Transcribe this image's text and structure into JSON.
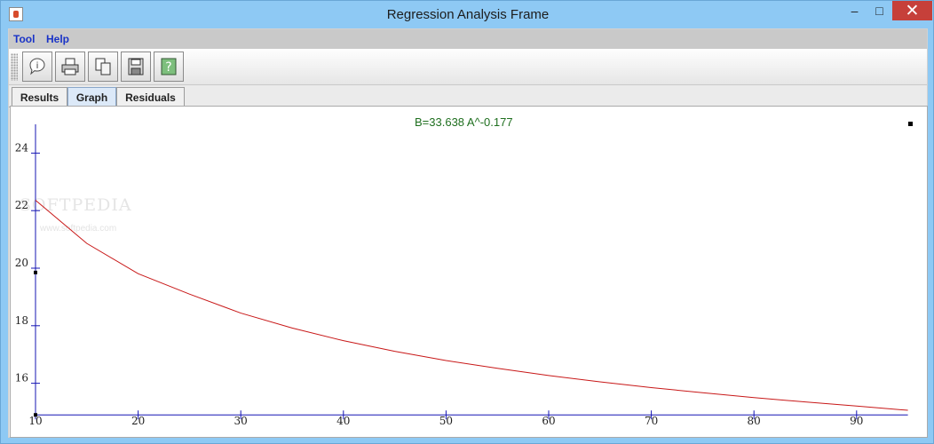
{
  "window": {
    "title": "Regression Analysis Frame",
    "minimize_glyph": "–",
    "maximize_glyph": "□",
    "close_glyph": "✕"
  },
  "menu": [
    "Tool",
    "Help"
  ],
  "toolbar": [
    "info-icon",
    "print-icon",
    "copy-icon",
    "save-icon",
    "help-icon"
  ],
  "tabs": [
    "Results",
    "Graph",
    "Residuals"
  ],
  "active_tab": "Graph",
  "graph": {
    "equation": "B=33.638 A^-0.177",
    "watermark": "SOFTPEDIA",
    "watermark_sub": "www.softpedia.com"
  },
  "chart_data": {
    "type": "line",
    "x_ticks": [
      10,
      20,
      30,
      40,
      50,
      60,
      70,
      80,
      90
    ],
    "y_ticks": [
      16,
      18,
      20,
      22,
      24
    ],
    "xlim": [
      10,
      95
    ],
    "ylim": [
      14.9,
      25
    ],
    "series": [
      {
        "x": [
          10,
          15,
          20,
          25,
          30,
          35,
          40,
          45,
          50,
          55,
          60,
          65,
          70,
          75,
          80,
          85,
          90,
          95
        ],
        "y": [
          22.36,
          20.86,
          19.81,
          19.1,
          18.44,
          17.92,
          17.48,
          17.11,
          16.79,
          16.52,
          16.27,
          16.05,
          15.85,
          15.67,
          15.5,
          15.35,
          15.21,
          15.06
        ],
        "color": "#c81818"
      }
    ],
    "points": [
      {
        "x": 10,
        "y": 19.85
      },
      {
        "x": 10,
        "y": 14.9
      }
    ],
    "colors": {
      "axis": "#1414b3",
      "tick_label": "#1f1f1f"
    }
  }
}
